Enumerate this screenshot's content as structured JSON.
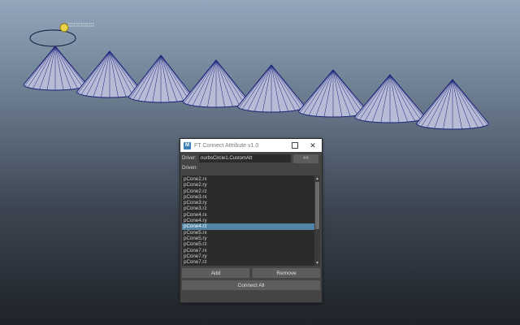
{
  "window": {
    "title": "FT Connect Attribute v1.0",
    "app_icon": "maya-icon",
    "controls": [
      "minimize-icon",
      "maximize-icon",
      "close-icon"
    ]
  },
  "driver": {
    "label": "Driver:",
    "value": "nurbsCircle1.CustomAtt",
    "load_label": "<<"
  },
  "driven": {
    "label": "Driven:",
    "items": [
      "pCone2.rx",
      "pCone2.ry",
      "pCone2.rz",
      "pCone3.rx",
      "pCone3.ry",
      "pCone3.rz",
      "pCone4.rx",
      "pCone4.ry",
      "pCone4.rz",
      "pCone5.rx",
      "pCone5.ry",
      "pCone5.rz",
      "pCone7.rx",
      "pCone7.ry",
      "pCone7.rz"
    ],
    "selected_index": 8
  },
  "buttons": {
    "add": "Add",
    "remove": "Remove",
    "connect_all": "Connect All"
  },
  "scene": {
    "objects": [
      "nurbsCircle1",
      "pCone1",
      "pCone2",
      "pCone3",
      "pCone4",
      "pCone5",
      "pCone6",
      "pCone7",
      "pCone8"
    ],
    "cone_color": "#b7bbd6",
    "wire_color": "#1a2378"
  }
}
